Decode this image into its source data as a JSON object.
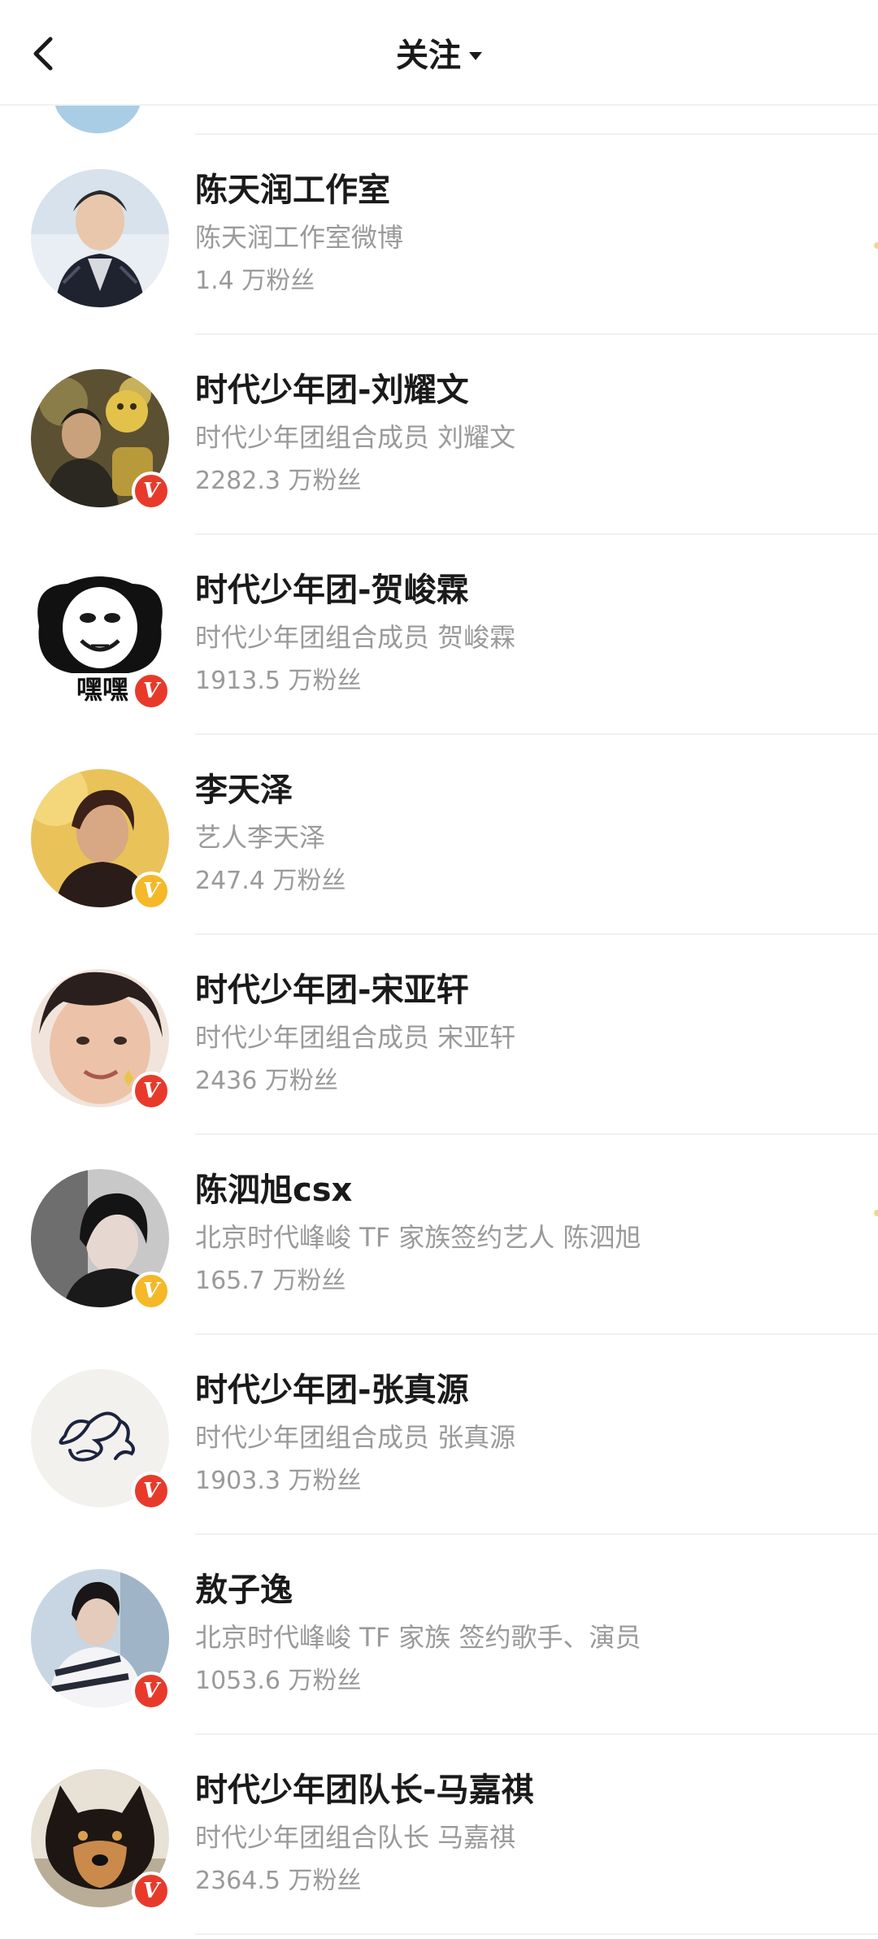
{
  "header": {
    "title": "关注",
    "back_icon": "chevron-left-icon",
    "dropdown_icon": "caret-down-icon"
  },
  "colors": {
    "verified_red": "#e83a2a",
    "verified_gold": "#f4b828",
    "secondary_text": "#9a9a9a"
  },
  "list": {
    "items": [
      {
        "name": "陈天润工作室",
        "desc": "陈天润工作室微博",
        "fans": "1.4 万粉丝",
        "badge": "none",
        "avatar": "avatar-photo"
      },
      {
        "name": "时代少年团-刘耀文",
        "desc": "时代少年团组合成员 刘耀文",
        "fans": "2282.3 万粉丝",
        "badge": "red",
        "avatar": "avatar-photo"
      },
      {
        "name": "时代少年团-贺峻霖",
        "desc": "时代少年团组合成员 贺峻霖",
        "fans": "1913.5 万粉丝",
        "badge": "red",
        "avatar": "avatar-meme",
        "avatar_text": "嘿嘿"
      },
      {
        "name": "李天泽",
        "desc": "艺人李天泽",
        "fans": "247.4 万粉丝",
        "badge": "gold",
        "avatar": "avatar-photo"
      },
      {
        "name": "时代少年团-宋亚轩",
        "desc": "时代少年团组合成员 宋亚轩",
        "fans": "2436 万粉丝",
        "badge": "red",
        "avatar": "avatar-photo"
      },
      {
        "name": "陈泗旭csx",
        "desc": "北京时代峰峻 TF 家族签约艺人 陈泗旭",
        "fans": "165.7 万粉丝",
        "badge": "gold",
        "avatar": "avatar-photo"
      },
      {
        "name": "时代少年团-张真源",
        "desc": "时代少年团组合成员 张真源",
        "fans": "1903.3 万粉丝",
        "badge": "red",
        "avatar": "avatar-doodle"
      },
      {
        "name": "敖子逸",
        "desc": "北京时代峰峻 TF 家族 签约歌手、演员",
        "fans": "1053.6 万粉丝",
        "badge": "red",
        "avatar": "avatar-photo"
      },
      {
        "name": "时代少年团队长-马嘉祺",
        "desc": "时代少年团组合队长 马嘉祺",
        "fans": "2364.5 万粉丝",
        "badge": "red",
        "avatar": "avatar-dog"
      }
    ],
    "verified_badge_glyph": "V"
  }
}
